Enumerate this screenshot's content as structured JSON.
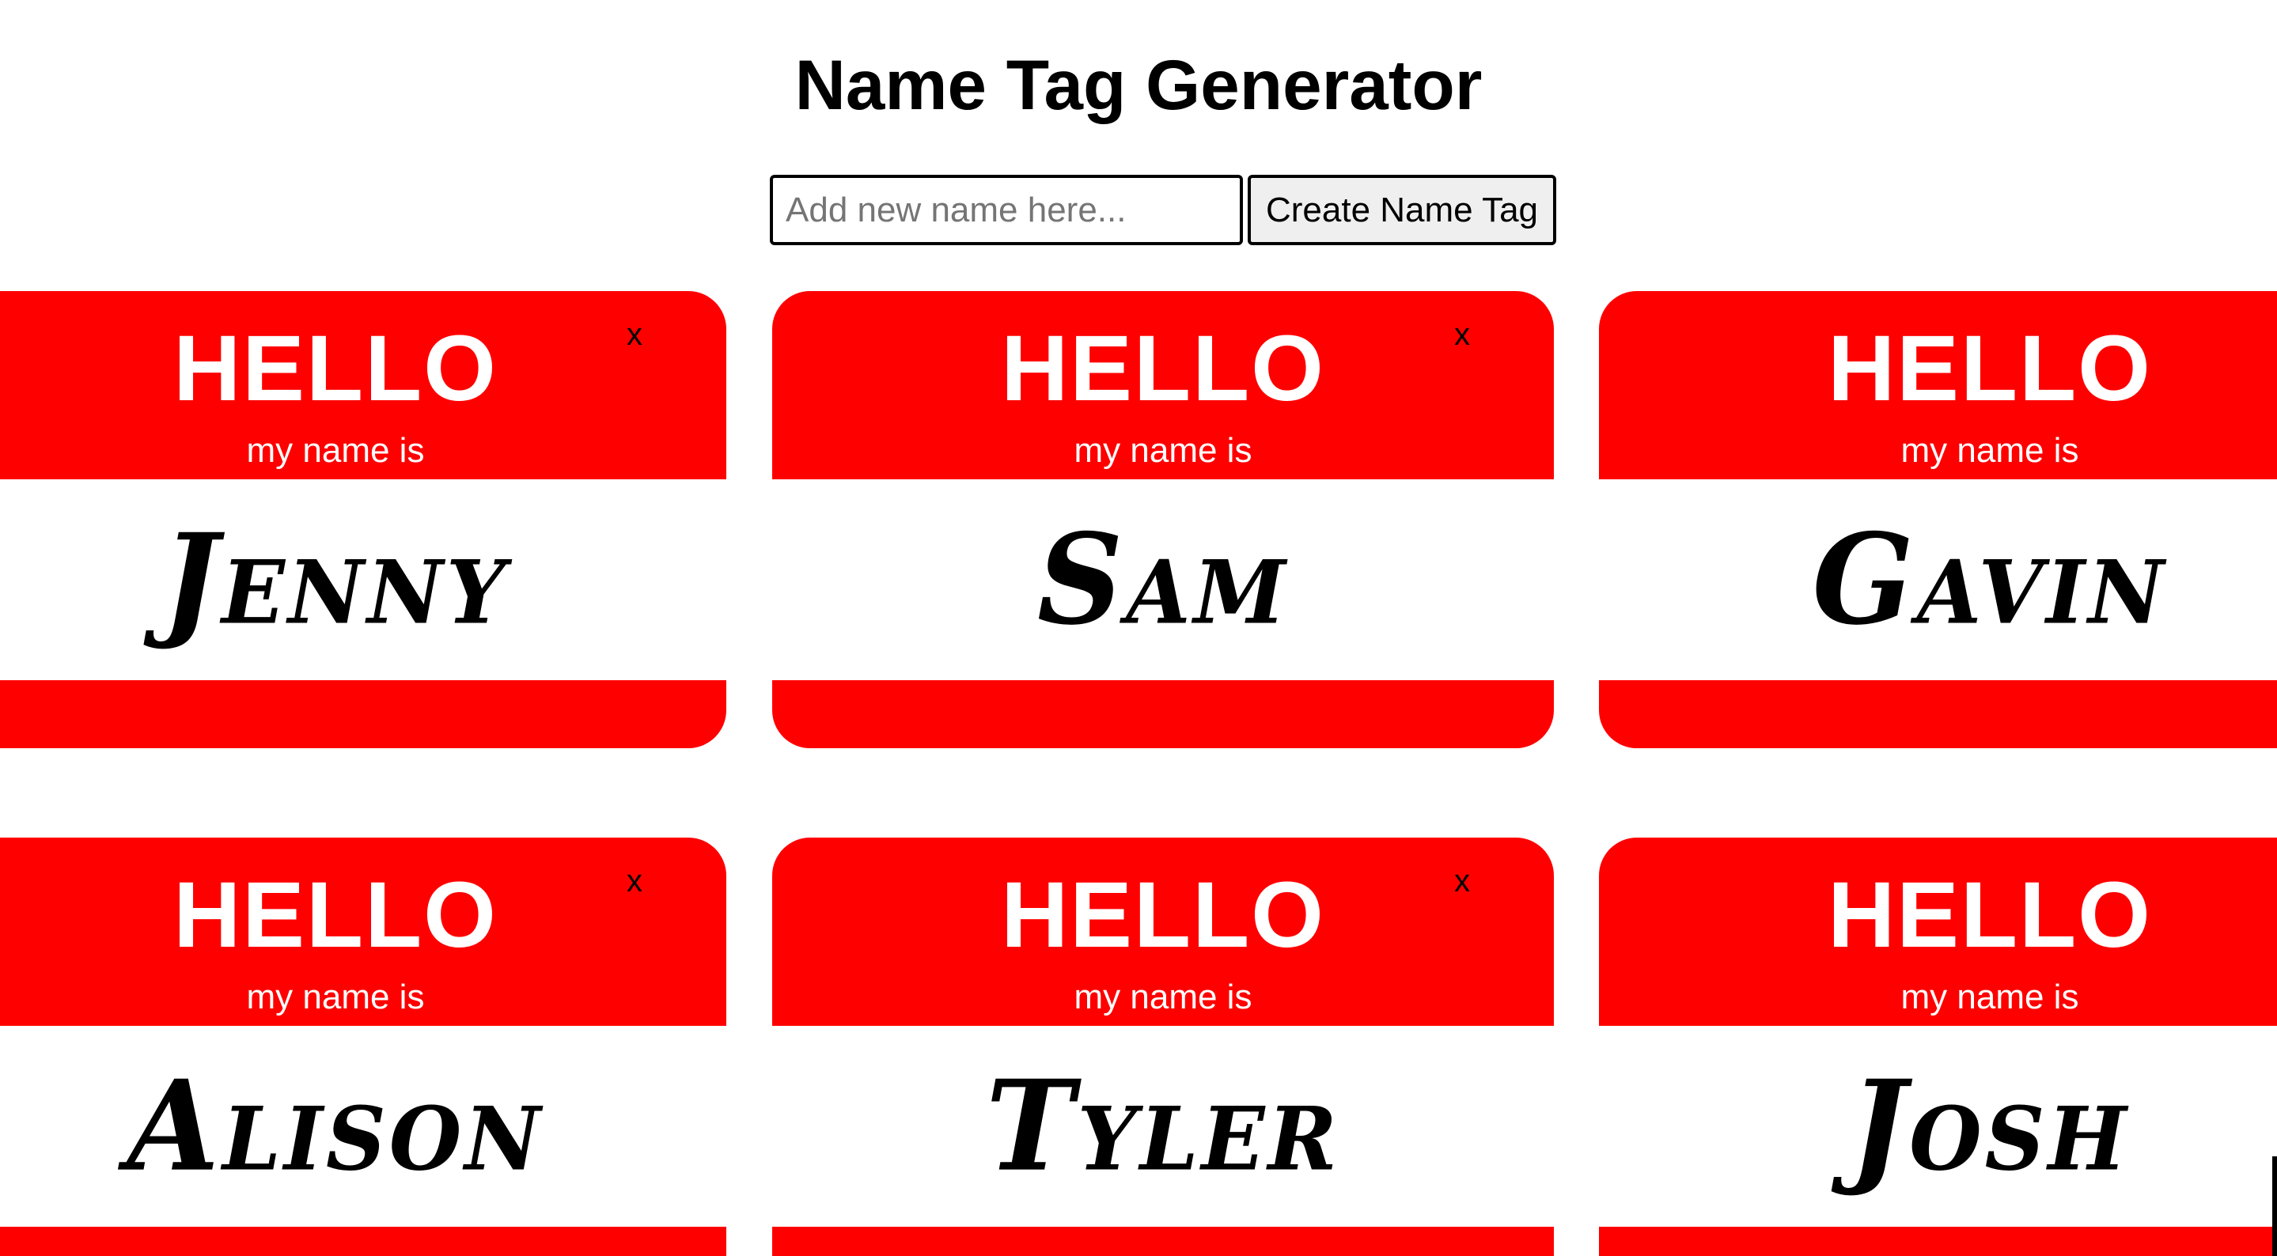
{
  "header": {
    "title": "Name Tag Generator"
  },
  "form": {
    "placeholder": "Add new name here...",
    "value": "",
    "button_label": "Create Name Tag"
  },
  "tags": [
    {
      "hello": "HELLO",
      "subtitle": "my name is",
      "name": "Jenny",
      "close": "x"
    },
    {
      "hello": "HELLO",
      "subtitle": "my name is",
      "name": "Sam",
      "close": "x"
    },
    {
      "hello": "HELLO",
      "subtitle": "my name is",
      "name": "Gavin"
    },
    {
      "hello": "HELLO",
      "subtitle": "my name is",
      "name": "Alison",
      "close": "x"
    },
    {
      "hello": "HELLO",
      "subtitle": "my name is",
      "name": "Tyler",
      "close": "x"
    },
    {
      "hello": "HELLO",
      "subtitle": "my name is",
      "name": "Josh"
    }
  ],
  "colors": {
    "tag_red": "#ff0000",
    "tag_text": "#ffffff",
    "name_text": "#000000"
  }
}
